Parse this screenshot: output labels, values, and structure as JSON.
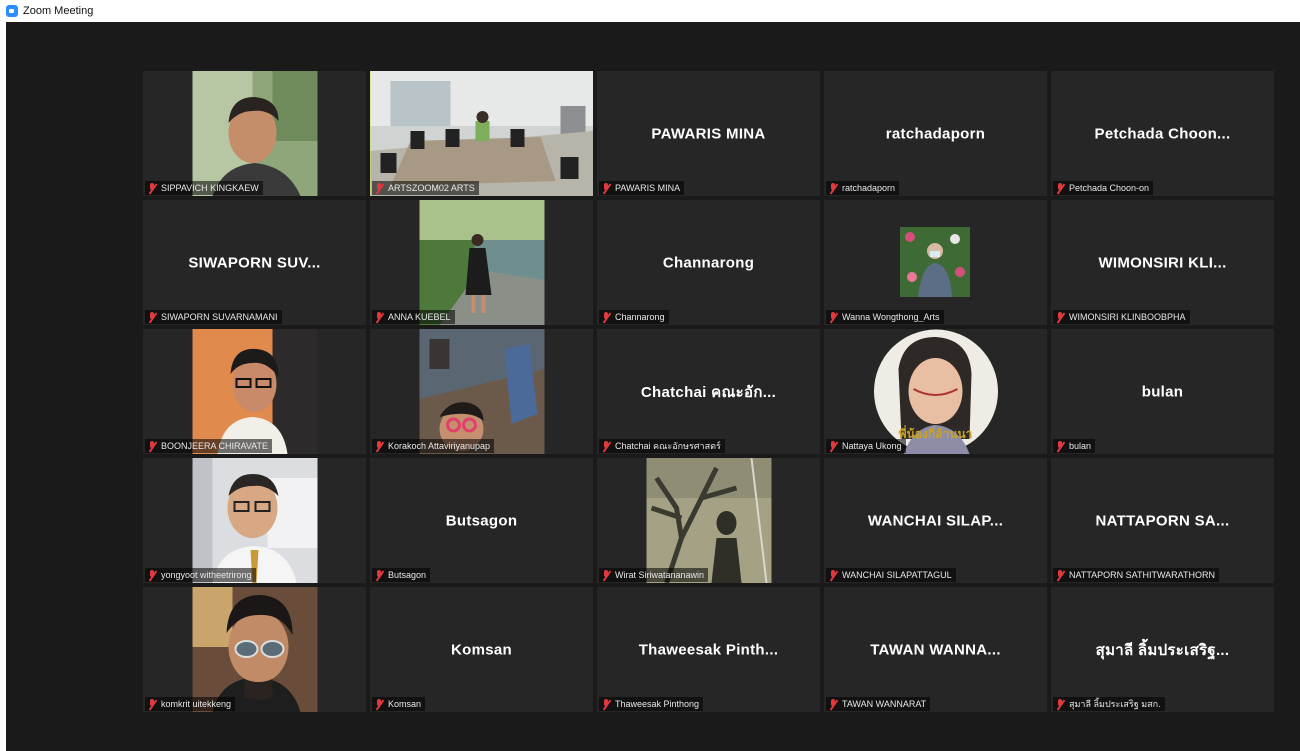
{
  "window": {
    "title": "Zoom Meeting",
    "accent": "#2d8cff"
  },
  "active_speaker_color": "#d6e85b",
  "muted_icon": "mic-muted-icon",
  "participants": [
    {
      "label": "SIPPAVICH KINGKAEW",
      "video": "portrait-man-green"
    },
    {
      "label": "ARTSZOOM02 ARTS",
      "video": "meeting-room",
      "active": true
    },
    {
      "big": "PAWARIS MINA",
      "label": "PAWARIS MINA"
    },
    {
      "big": "ratchadaporn",
      "label": "ratchadaporn"
    },
    {
      "big": "Petchada Choon...",
      "label": "Petchada Choon-on"
    },
    {
      "big": "SIWAPORN SUV...",
      "label": "SIWAPORN SUVARNAMANI"
    },
    {
      "label": "ANNA KUEBEL",
      "video": "woman-garden"
    },
    {
      "big": "Channarong",
      "label": "Channarong"
    },
    {
      "label": "Wanna Wongthong_Arts",
      "video": "woman-flowers-small"
    },
    {
      "big": "WIMONSIRI KLI...",
      "label": "WIMONSIRI KLINBOOBPHA"
    },
    {
      "label": "BOONJEERA CHIRAVATE",
      "video": "woman-glasses-orange"
    },
    {
      "label": "Korakoch Attaviriyanupap",
      "video": "selfie-building"
    },
    {
      "big": "Chatchai คณะอัก...",
      "label": "Chatchai คณะอักษรศาสตร์"
    },
    {
      "label": "Nattaya Ukong",
      "video": "painted-portrait-circle",
      "overlay": "พี่น้องกี่ล้านนา"
    },
    {
      "big": "bulan",
      "label": "bulan"
    },
    {
      "label": "yongyoot witheetrirong",
      "video": "man-glasses-office"
    },
    {
      "big": "Butsagon",
      "label": "Butsagon"
    },
    {
      "label": "Wirat Siriwatananawin",
      "video": "tree-shadow"
    },
    {
      "big": "WANCHAI SILAP...",
      "label": "WANCHAI SILAPATTAGUL"
    },
    {
      "big": "NATTAPORN SA...",
      "label": "NATTAPORN SATHITWARATHORN"
    },
    {
      "label": "komkrit uitekkeng",
      "video": "man-sunglasses"
    },
    {
      "big": "Komsan",
      "label": "Komsan"
    },
    {
      "big": "Thaweesak Pinth...",
      "label": "Thaweesak Pinthong"
    },
    {
      "big": "TAWAN WANNA...",
      "label": "TAWAN WANNARAT"
    },
    {
      "big": "สุมาลี ลิ้มประเสริฐ...",
      "label": "สุมาลี ลิ้มประเสริฐ มสก."
    }
  ]
}
